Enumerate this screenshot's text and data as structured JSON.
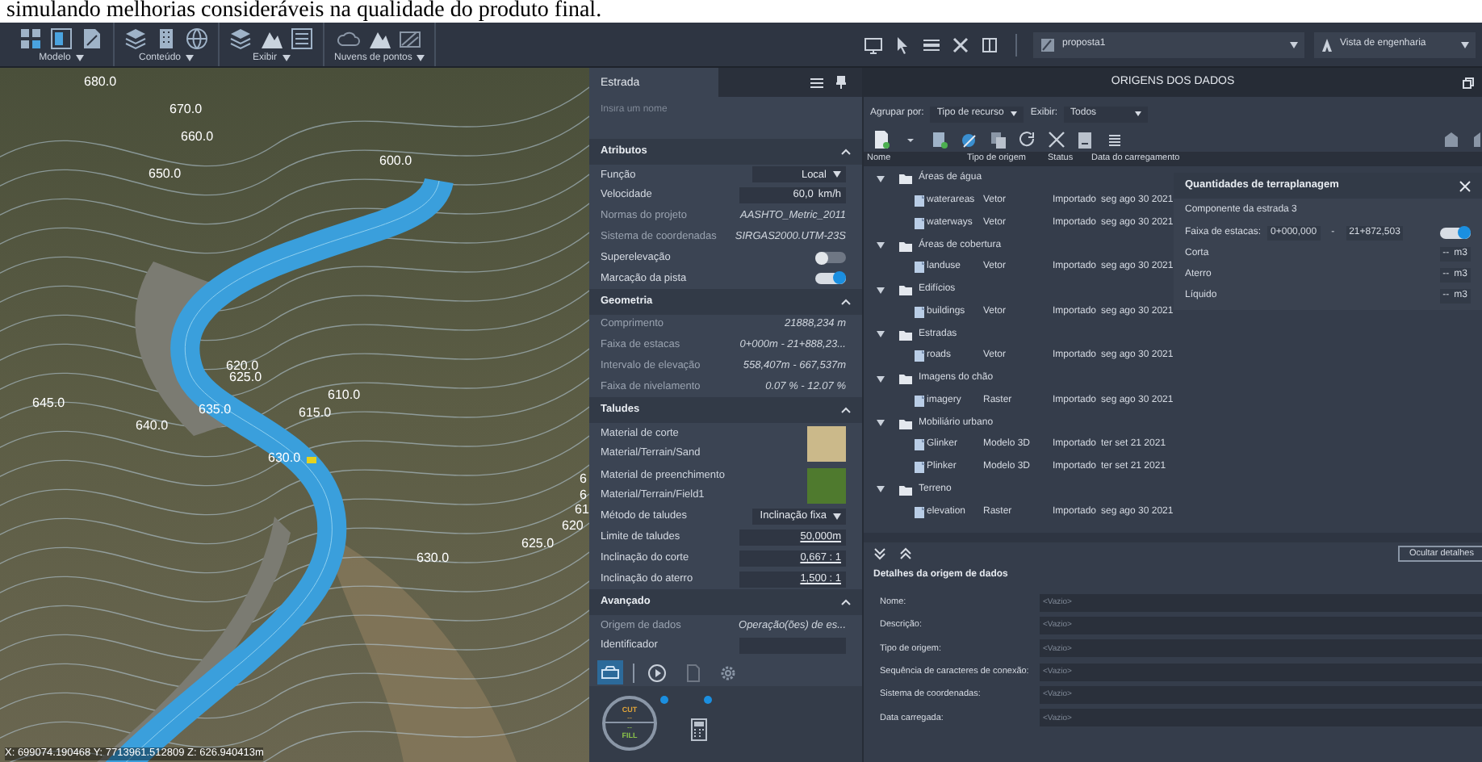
{
  "caption": "simulando melhorias consideráveis na qualidade do produto final.",
  "toolbar": {
    "groups": [
      "Modelo",
      "Conteúdo",
      "Exibir",
      "Nuvens de pontos"
    ],
    "project_selector": "proposta1",
    "view_selector": "Vista de engenharia"
  },
  "viewport": {
    "contour_labels": [
      "680.0",
      "670.0",
      "660.0",
      "650.0",
      "600.0",
      "620.0",
      "625.0",
      "610.0",
      "645.0",
      "635.0",
      "615.0",
      "640.0",
      "630.0",
      "6",
      "6",
      "61",
      "620",
      "625.0",
      "630.0"
    ],
    "coordinates": "X: 699074.190468 Y: 7713961.512809 Z: 626.940413m"
  },
  "properties": {
    "title": "Estrada",
    "name_placeholder": "Insira um nome",
    "sections": [
      {
        "title": "Atributos",
        "expanded": true,
        "rows": [
          {
            "kind": "dropdown",
            "label": "Função",
            "value": "Local"
          },
          {
            "kind": "input",
            "label": "Velocidade",
            "value": "60,0",
            "unit": "km/h"
          },
          {
            "kind": "text",
            "label": "Normas do projeto",
            "value": "AASHTO_Metric_2011"
          },
          {
            "kind": "text",
            "label": "Sistema de coordenadas",
            "value": "SIRGAS2000.UTM-23S"
          },
          {
            "kind": "toggle",
            "label": "Superelevação",
            "on": false
          },
          {
            "kind": "toggle",
            "label": "Marcação da pista",
            "on": true
          }
        ]
      },
      {
        "title": "Geometria",
        "expanded": true,
        "rows": [
          {
            "kind": "text",
            "label": "Comprimento",
            "value": "21888,234  m"
          },
          {
            "kind": "text",
            "label": "Faixa de estacas",
            "value": "0+000m - 21+888,23..."
          },
          {
            "kind": "text",
            "label": "Intervalo de elevação",
            "value": "558,407m - 667,537m"
          },
          {
            "kind": "text",
            "label": "Faixa de nivelamento",
            "value": "0.07 % - 12.07 %"
          }
        ]
      },
      {
        "title": "Taludes",
        "expanded": true,
        "rows": [
          {
            "kind": "material",
            "label": "Material de corte",
            "value": "Material/Terrain/Sand",
            "color": "#cbb98a"
          },
          {
            "kind": "material",
            "label": "Material de preenchimento",
            "value": "Material/Terrain/Field1",
            "color": "#4f7a2e"
          },
          {
            "kind": "dropdown",
            "label": "Método de taludes",
            "value": "Inclinação fixa"
          },
          {
            "kind": "link",
            "label": "Limite de taludes",
            "value": "50,000m"
          },
          {
            "kind": "link",
            "label": "Inclinação do corte",
            "value": "0,667 : 1"
          },
          {
            "kind": "link",
            "label": "Inclinação do aterro",
            "value": "1,500 : 1"
          }
        ]
      },
      {
        "title": "Avançado",
        "expanded": true,
        "rows": [
          {
            "kind": "text",
            "label": "Origem de dados",
            "value": "Operação(ões) de es..."
          },
          {
            "kind": "input",
            "label": "Identificador"
          }
        ]
      }
    ],
    "tools": [
      {
        "selected": true
      },
      {
        "selected": false
      },
      {
        "selected": false
      },
      {
        "selected": false
      }
    ],
    "cut_fill": {
      "cut_label": "CUT",
      "cut_value": "--",
      "fill_value": "--",
      "fill_label": "FILL"
    }
  },
  "data_sources": {
    "title": "ORIGENS DOS DADOS",
    "group_by_label": "Agrupar por:",
    "group_by": "Tipo de recurso",
    "show_label": "Exibir:",
    "show": "Todos",
    "columns": [
      "Nome",
      "Tipo de origem",
      "Status",
      "Data do carregamento"
    ],
    "tree": [
      {
        "name": "Áreas de água",
        "expanded": true,
        "children": [
          {
            "name": "waterareas",
            "type": "Vetor",
            "status": "Importado",
            "date": "seg ago 30 2021"
          },
          {
            "name": "waterways",
            "type": "Vetor",
            "status": "Importado",
            "date": "seg ago 30 2021"
          }
        ]
      },
      {
        "name": "Áreas de cobertura",
        "expanded": true,
        "children": [
          {
            "name": "landuse",
            "type": "Vetor",
            "status": "Importado",
            "date": "seg ago 30 2021"
          }
        ]
      },
      {
        "name": "Edifícios",
        "expanded": true,
        "children": [
          {
            "name": "buildings",
            "type": "Vetor",
            "status": "Importado",
            "date": "seg ago 30 2021"
          }
        ]
      },
      {
        "name": "Estradas",
        "expanded": true,
        "children": [
          {
            "name": "roads",
            "type": "Vetor",
            "status": "Importado",
            "date": "seg ago 30 2021"
          }
        ]
      },
      {
        "name": "Imagens do chão",
        "expanded": true,
        "children": [
          {
            "name": "imagery",
            "type": "Raster",
            "status": "Importado",
            "date": "seg ago 30 2021"
          }
        ]
      },
      {
        "name": "Mobiliário urbano",
        "expanded": true,
        "children": [
          {
            "name": "Glinker",
            "type": "Modelo 3D",
            "status": "Importado",
            "date": "ter set 21 2021"
          },
          {
            "name": "Plinker",
            "type": "Modelo 3D",
            "status": "Importado",
            "date": "ter set 21 2021"
          }
        ]
      },
      {
        "name": "Terreno",
        "expanded": true,
        "children": [
          {
            "name": "elevation",
            "type": "Raster",
            "status": "Importado",
            "date": "seg ago 30 2021"
          }
        ]
      }
    ]
  },
  "earthwork": {
    "title": "Quantidades de terraplanagem",
    "component": "Componente da estrada 3",
    "range_label": "Faixa de estacas:",
    "range_start": "0+000,000",
    "range_sep": "-",
    "range_end": "21+872,503",
    "range_on": true,
    "rows": [
      {
        "label": "Corta",
        "value": "--",
        "unit": "m3"
      },
      {
        "label": "Aterro",
        "value": "--",
        "unit": "m3"
      },
      {
        "label": "Líquido",
        "value": "--",
        "unit": "m3"
      }
    ]
  },
  "details": {
    "hide_button": "Ocultar detalhes",
    "title": "Detalhes da origem de dados",
    "fields": [
      {
        "label": "Nome:",
        "placeholder": "<Vazio>"
      },
      {
        "label": "Descrição:",
        "placeholder": "<Vazio>"
      },
      {
        "label": "Tipo de origem:",
        "placeholder": "<Vazio>"
      },
      {
        "label": "Sequência de caracteres de conexão:",
        "placeholder": "<Vazio>"
      },
      {
        "label": "Sistema de coordenadas:",
        "placeholder": "<Vazio>"
      },
      {
        "label": "Data carregada:",
        "placeholder": "<Vazio>"
      }
    ]
  }
}
